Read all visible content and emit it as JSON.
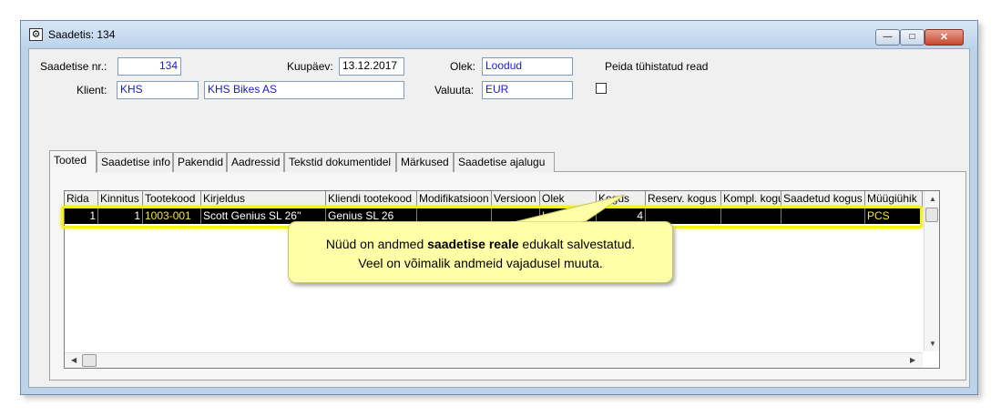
{
  "window": {
    "title": "Saadetis: 134",
    "icon": "gear-icon",
    "min_label": "—",
    "max_label": "□",
    "close_label": "✕"
  },
  "form": {
    "shipment_nr_label": "Saadetise nr.:",
    "shipment_nr_value": "134",
    "date_label": "Kuupäev:",
    "date_value": "13.12.2017",
    "status_label": "Olek:",
    "status_value": "Loodud",
    "hide_cancelled_label": "Peida tühistatud read",
    "client_label": "Klient:",
    "client_code": "KHS",
    "client_name": "KHS Bikes AS",
    "currency_label": "Valuuta:",
    "currency_value": "EUR"
  },
  "tabs": [
    "Tooted",
    "Saadetise info",
    "Pakendid",
    "Aadressid",
    "Tekstid dokumentidel",
    "Märkused",
    "Saadetise ajalugu"
  ],
  "grid": {
    "columns": [
      "Rida",
      "Kinnitus",
      "Tootekood",
      "Kirjeldus",
      "Kliendi tootekood",
      "Modifikatsioon",
      "Versioon",
      "Olek",
      "Kogus",
      "Reserv. kogus",
      "Kompl. kogus",
      "Saadetud kogus",
      "Müügiühik"
    ],
    "rows": [
      [
        "1",
        "1",
        "1003-001",
        "Scott Genius SL 26''",
        "Genius SL 26",
        "",
        "",
        "Loodud",
        "4",
        "",
        "",
        "",
        "PCS"
      ]
    ]
  },
  "callout": {
    "text_before": "Nüüd on andmed ",
    "text_bold": "saadetise reale",
    "text_after": " edukalt salvestatud.",
    "line2": "Veel on võimalik andmeid vajadusel muuta."
  },
  "colors": {
    "highlight": "#f4f21a",
    "value_text": "#1a1ad0",
    "row_bg": "#000000",
    "callout_bg": "#ffffa8"
  }
}
